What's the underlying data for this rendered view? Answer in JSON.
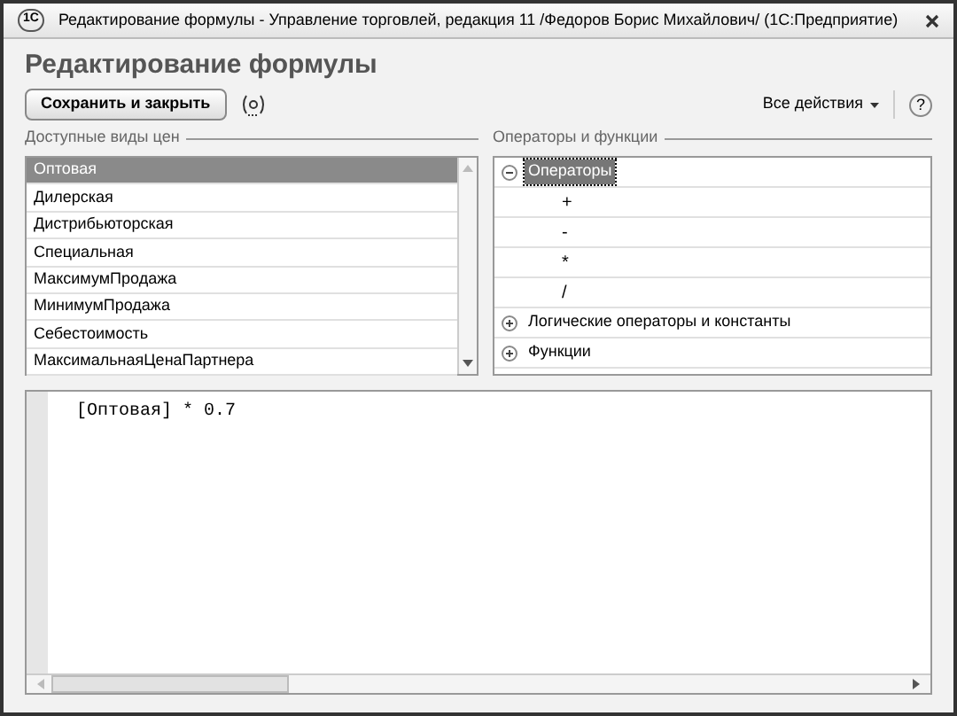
{
  "window": {
    "title": "Редактирование формулы - Управление торговлей, редакция 11 /Федоров Борис Михайлович/  (1С:Предприятие)",
    "logo": "1С"
  },
  "heading": "Редактирование формулы",
  "toolbar": {
    "save_button": "Сохранить и закрыть",
    "all_actions": "Все действия",
    "help": "?"
  },
  "price_types": {
    "label": "Доступные виды цен",
    "items": [
      {
        "name": "Оптовая",
        "selected": true
      },
      {
        "name": "Дилерская",
        "selected": false
      },
      {
        "name": "Дистрибьюторская",
        "selected": false
      },
      {
        "name": "Специальная",
        "selected": false
      },
      {
        "name": "МаксимумПродажа",
        "selected": false
      },
      {
        "name": "МинимумПродажа",
        "selected": false
      },
      {
        "name": "Себестоимость",
        "selected": false
      },
      {
        "name": "МаксимальнаяЦенаПартнера",
        "selected": false
      }
    ]
  },
  "operators": {
    "label": "Операторы и функции",
    "items": [
      {
        "name": "Операторы",
        "expanded": true,
        "selected": true,
        "children": [
          {
            "name": "+"
          },
          {
            "name": "-"
          },
          {
            "name": "*"
          },
          {
            "name": "/"
          }
        ]
      },
      {
        "name": "Логические операторы и константы",
        "expanded": false,
        "selected": false
      },
      {
        "name": "Функции",
        "expanded": false,
        "selected": false
      }
    ]
  },
  "formula": "[Оптовая] * 0.7"
}
